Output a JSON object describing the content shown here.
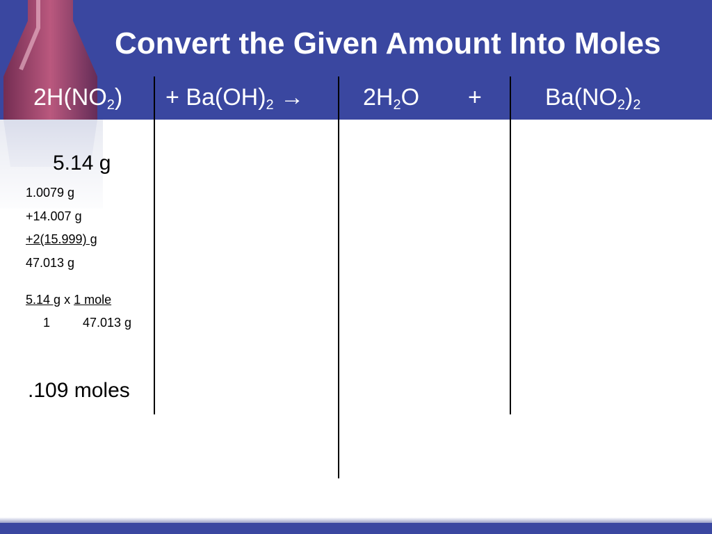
{
  "slide": {
    "title": "Convert the Given Amount Into Moles"
  },
  "equation": {
    "reactant1": {
      "prefix": "2H(NO",
      "sub": "2",
      "suffix": ")"
    },
    "reactant2": {
      "prefix": "+ Ba(OH)",
      "sub": "2",
      "arrow": "→"
    },
    "product1": {
      "prefix": "2H",
      "sub": "2",
      "suffix": "O"
    },
    "plus": "+",
    "product2": {
      "prefix": "Ba(NO",
      "sub1": "2",
      "mid": ")",
      "sub2": "2"
    }
  },
  "work": {
    "given": "5.14 g",
    "molar_mass_lines": [
      "1.0079 g",
      "+14.007 g",
      "+2(15.999) g",
      "47.013 g"
    ],
    "conversion": {
      "numerator_left": "5.14 g",
      "times": "x",
      "numerator_right": "1 mole",
      "denominator_left": "1",
      "denominator_right": "47.013 g"
    },
    "result": ".109 moles"
  },
  "colors": {
    "header": "#3a47a0",
    "text_on_header": "#ffffff"
  }
}
